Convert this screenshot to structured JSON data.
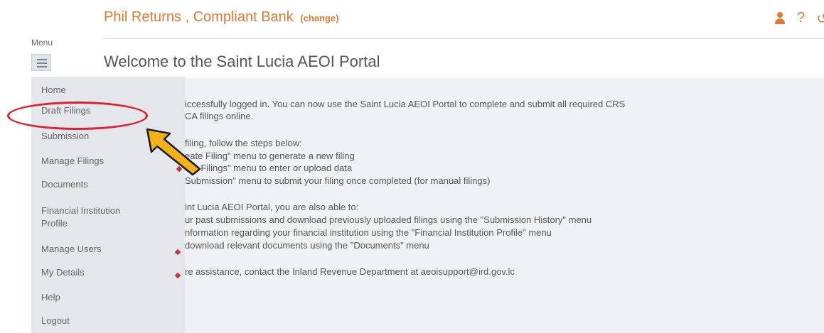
{
  "header": {
    "title": "Phil Returns , Compliant Bank",
    "change_label": "(change)",
    "icons": [
      "user-icon",
      "help-icon",
      "logout-icon"
    ]
  },
  "menu": {
    "label": "Menu",
    "items": [
      {
        "label": "Home"
      },
      {
        "label": "Draft Filings"
      },
      {
        "label": "Submission"
      },
      {
        "label": "Manage Filings"
      },
      {
        "label": "Documents"
      },
      {
        "label": "Financial Institution"
      },
      {
        "label": "Profile"
      },
      {
        "label": "Manage Users"
      },
      {
        "label": "My Details"
      },
      {
        "label": "Help"
      },
      {
        "label": "Logout"
      }
    ]
  },
  "main": {
    "title": "Welcome to the Saint Lucia AEOI Portal",
    "lines": [
      "iccessfully logged in. You can now use the Saint Lucia AEOI Portal to complete and submit all required CRS",
      "CA filings online.",
      "filing, follow the steps below:",
      "eate Filing\" menu to generate a new filing",
      "raft Filings\" menu to enter or upload data",
      "Submission\" menu to submit your filing once completed (for manual filings)",
      "int Lucia AEOI Portal, you are also able to:",
      "ur past submissions and download previously uploaded filings using the \"Submission History\" menu",
      "nformation regarding your financial institution using the \"Financial Institution Profile\" menu",
      "download relevant documents using the \"Documents\" menu",
      "re assistance, contact the Inland Revenue Department at aeoisupport@ird.gov.lc"
    ]
  },
  "colors": {
    "accent": "#e07a33",
    "highlight": "#e01f2f",
    "arrow": "#f3b21a"
  }
}
